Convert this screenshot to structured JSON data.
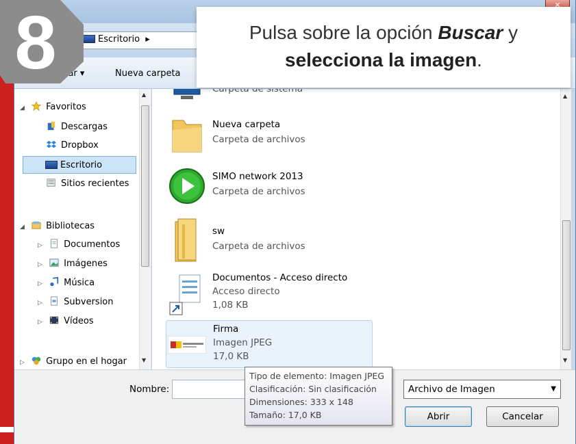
{
  "window": {
    "close_glyph": "✕"
  },
  "address": {
    "crumb": "Escritorio",
    "crumb_arrow": "▸"
  },
  "toolbar": {
    "organize": "izar ▾",
    "new_folder": "Nueva carpeta"
  },
  "nav": {
    "favorites": "Favoritos",
    "items_fav": [
      "Descargas",
      "Dropbox",
      "Escritorio",
      "Sitios recientes"
    ],
    "libraries": "Bibliotecas",
    "items_lib": [
      "Documentos",
      "Imágenes",
      "Música",
      "Subversion",
      "Vídeos"
    ],
    "homegroup": "Grupo en el hogar"
  },
  "files": [
    {
      "name": "",
      "meta1": "Carpeta de sistema",
      "icon": "computer-icon"
    },
    {
      "name": "Nueva carpeta",
      "meta1": "Carpeta de archivos",
      "icon": "folder-icon"
    },
    {
      "name": "SIMO network 2013",
      "meta1": "Carpeta de archivos",
      "icon": "play-icon"
    },
    {
      "name": "sw",
      "meta1": "Carpeta de archivos",
      "icon": "folder-icon"
    },
    {
      "name": "Documentos - Acceso directo",
      "meta1": "Acceso directo",
      "meta2": "1,08 KB",
      "icon": "shortcut-document-icon"
    },
    {
      "name": "Firma",
      "meta1": "Imagen JPEG",
      "meta2": "17,0 KB",
      "icon": "jpeg-thumbnail"
    }
  ],
  "bottom": {
    "name_label": "Nombre:",
    "filter": "Archivo de Imagen",
    "open": "Abrir",
    "cancel": "Cancelar"
  },
  "tooltip": {
    "lines": [
      "Tipo de elemento: Imagen JPEG",
      "Clasificación: Sin clasificación",
      "Dimensiones: 333 x 148",
      "Tamaño: 17,0 KB"
    ]
  },
  "callout": {
    "part1": "Pulsa sobre la opción ",
    "bold1": "Buscar",
    "part2": " y",
    "bold2": "selecciona la imagen",
    "part3": "."
  },
  "badge": {
    "number": "8"
  },
  "colors": {
    "accent_red": "#cc1f1f",
    "badge_gray": "#8c8c8c"
  }
}
